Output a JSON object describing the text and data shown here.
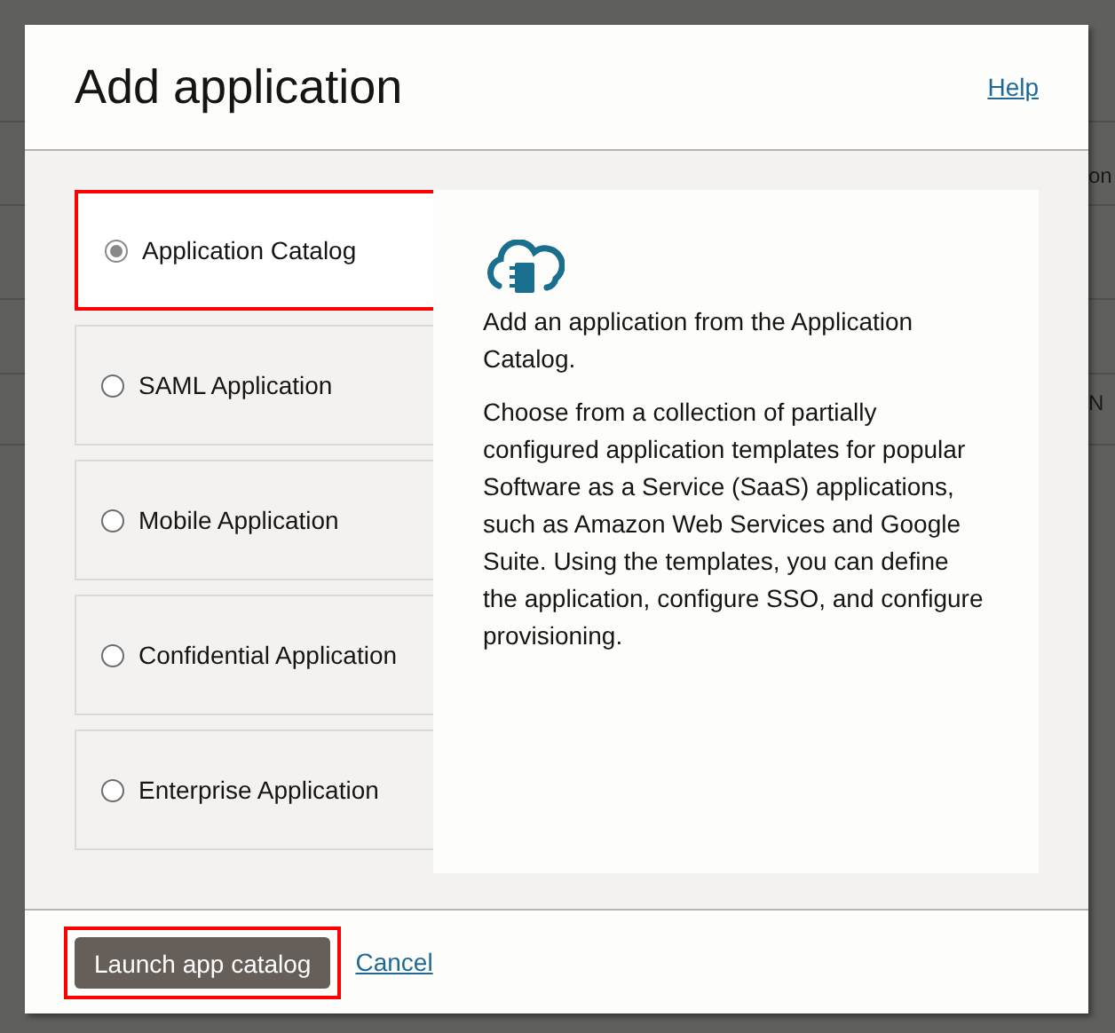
{
  "background": {
    "fragments": [
      "on",
      "N"
    ]
  },
  "dialog": {
    "title": "Add application",
    "help_link": "Help",
    "options": [
      {
        "label": "Application Catalog",
        "selected": true
      },
      {
        "label": "SAML Application",
        "selected": false
      },
      {
        "label": "Mobile Application",
        "selected": false
      },
      {
        "label": "Confidential Application",
        "selected": false
      },
      {
        "label": "Enterprise Application",
        "selected": false
      }
    ],
    "detail": {
      "summary": "Add an application from the Application Catalog.",
      "description": "Choose from a collection of partially configured application templates for popular Software as a Service (SaaS) applications, such as Amazon Web Services and Google Suite. Using the templates, you can define the application, configure SSO, and configure provisioning."
    },
    "primary_button": {
      "label": "Launch app catalog",
      "highlighted": true
    },
    "cancel_link": "Cancel"
  }
}
